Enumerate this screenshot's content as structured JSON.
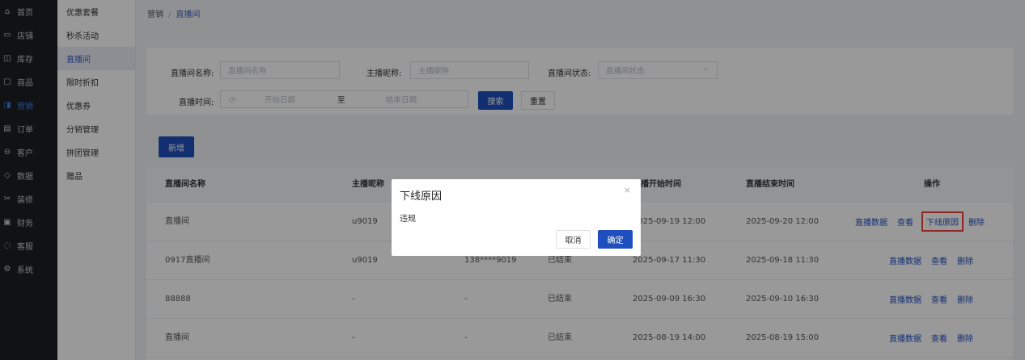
{
  "main_nav": [
    {
      "label": "首页",
      "icon": "home-icon",
      "glyph": "⌂",
      "active": false
    },
    {
      "label": "店铺",
      "icon": "store-icon",
      "glyph": "▭",
      "active": false
    },
    {
      "label": "库存",
      "icon": "inventory-icon",
      "glyph": "◫",
      "active": false
    },
    {
      "label": "商品",
      "icon": "goods-icon",
      "glyph": "▢",
      "active": false
    },
    {
      "label": "营销",
      "icon": "gift-icon",
      "glyph": "◨",
      "active": true
    },
    {
      "label": "订单",
      "icon": "order-icon",
      "glyph": "▤",
      "active": false
    },
    {
      "label": "客户",
      "icon": "customer-icon",
      "glyph": "⊖",
      "active": false
    },
    {
      "label": "数据",
      "icon": "data-icon",
      "glyph": "◇",
      "active": false
    },
    {
      "label": "装修",
      "icon": "decorate-icon",
      "glyph": "✂",
      "active": false
    },
    {
      "label": "财务",
      "icon": "finance-icon",
      "glyph": "▣",
      "active": false
    },
    {
      "label": "客服",
      "icon": "service-icon",
      "glyph": "◌",
      "active": false
    },
    {
      "label": "系统",
      "icon": "settings-icon",
      "glyph": "⚙",
      "active": false
    }
  ],
  "sub_nav": [
    {
      "label": "优惠套餐",
      "active": false
    },
    {
      "label": "秒杀活动",
      "active": false
    },
    {
      "label": "直播间",
      "active": true
    },
    {
      "label": "限时折扣",
      "active": false
    },
    {
      "label": "优惠券",
      "active": false
    },
    {
      "label": "分销管理",
      "active": false
    },
    {
      "label": "拼团管理",
      "active": false
    },
    {
      "label": "赠品",
      "active": false
    }
  ],
  "breadcrumb": {
    "parent": "营销",
    "separator": "/",
    "current": "直播间"
  },
  "filters": {
    "room_name_label": "直播间名称:",
    "room_name_placeholder": "直播间名称",
    "host_label": "主播昵称:",
    "host_placeholder": "主播昵称",
    "status_label": "直播间状态:",
    "status_placeholder": "直播间状态",
    "time_label": "直播时间:",
    "start_placeholder": "开始日期",
    "range_sep": "至",
    "end_placeholder": "结束日期",
    "search_button": "搜索",
    "reset_button": "重置"
  },
  "add_button": "新增",
  "table": {
    "headers": [
      "直播间名称",
      "主播昵称",
      "",
      "",
      "直播开始时间",
      "直播结束时间",
      "操作"
    ],
    "rows": [
      {
        "name": "直播间",
        "host": "u9019",
        "phone": "",
        "status": "",
        "start": "2025-09-19 12:00",
        "end": "2025-09-20 12:00",
        "ops": [
          "直播数据",
          "查看",
          "下线原因",
          "删除"
        ]
      },
      {
        "name": "0917直播间",
        "host": "u9019",
        "phone": "138****9019",
        "status": "已结束",
        "start": "2025-09-17 11:30",
        "end": "2025-09-18 11:30",
        "ops": [
          "直播数据",
          "查看",
          "删除"
        ]
      },
      {
        "name": "88888",
        "host": "-",
        "phone": "-",
        "status": "已结束",
        "start": "2025-09-09 16:30",
        "end": "2025-09-10 16:30",
        "ops": [
          "直播数据",
          "查看",
          "删除"
        ]
      },
      {
        "name": "直播间",
        "host": "-",
        "phone": "-",
        "status": "已结束",
        "start": "2025-08-19 14:00",
        "end": "2025-08-19 15:00",
        "ops": [
          "直播数据",
          "查看",
          "删除"
        ]
      }
    ]
  },
  "dialog": {
    "title": "下线原因",
    "close_glyph": "×",
    "message": "违规",
    "cancel_label": "取消",
    "confirm_label": "确定"
  },
  "colors": {
    "primary": "#1f4fbf",
    "highlight_border": "#f0403b",
    "sidebar_bg": "#1d1e22"
  }
}
